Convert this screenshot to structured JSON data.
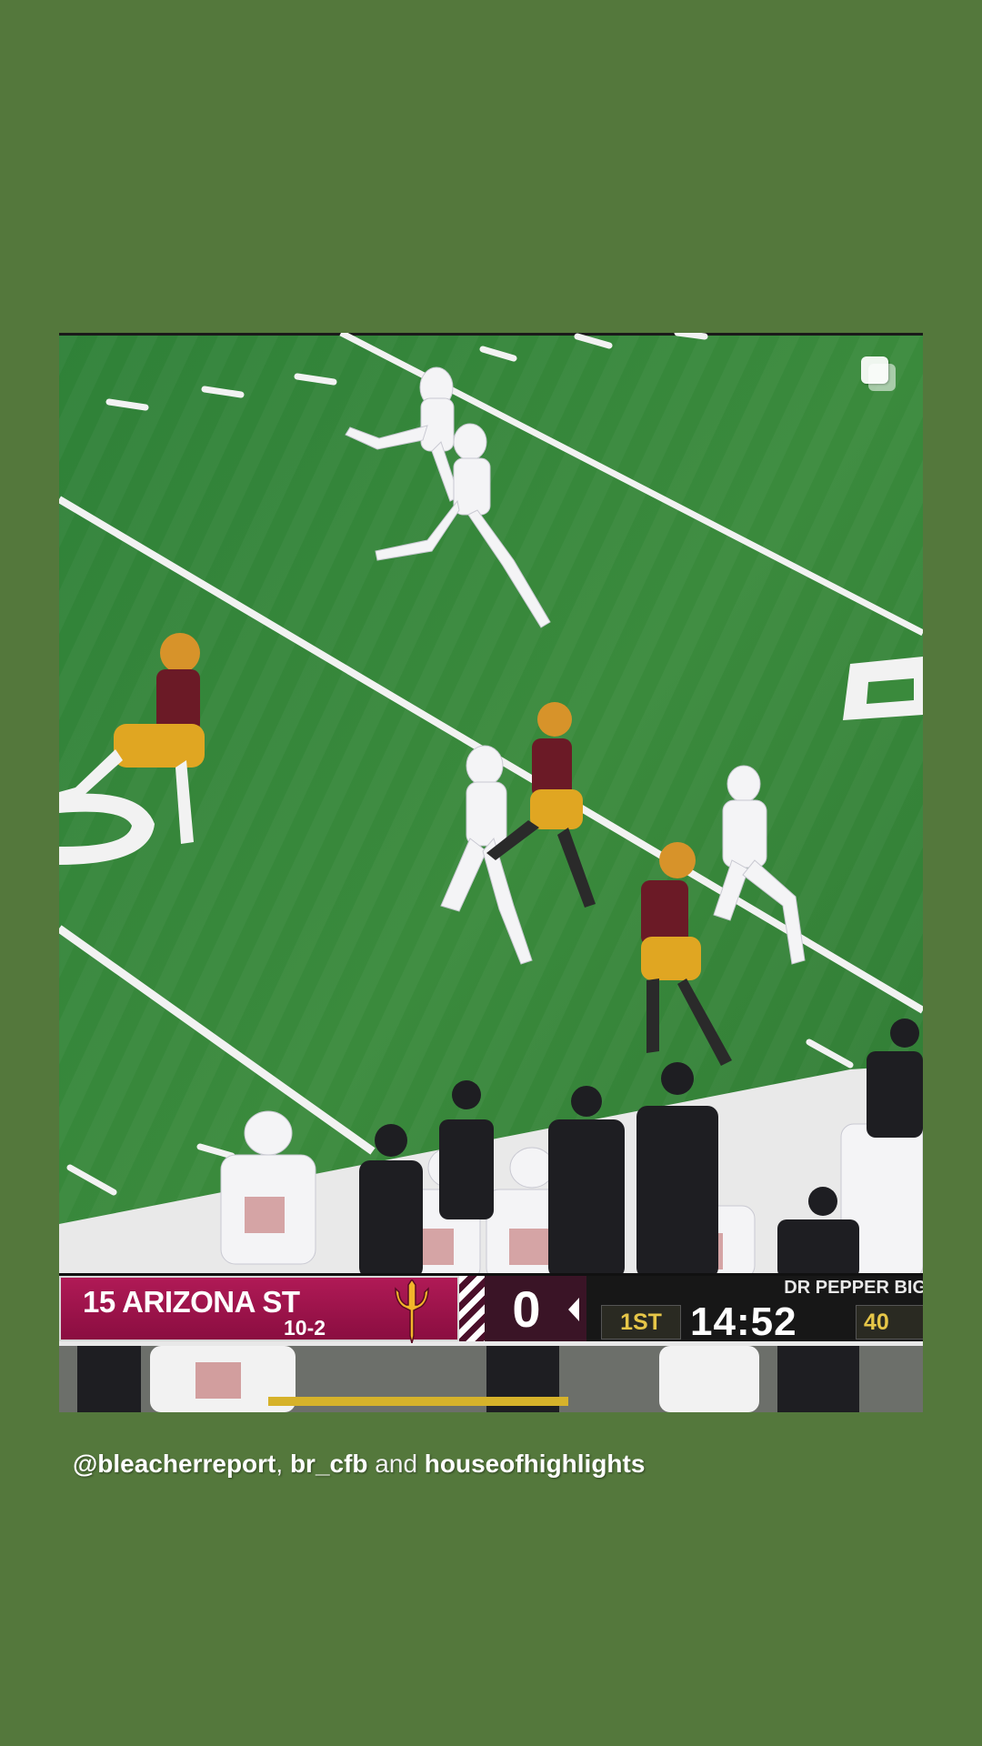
{
  "post": {
    "media_description_icon": "carousel-multiple-icon",
    "scorebug": {
      "team_rank": "15",
      "team_name": "15 ARIZONA ST",
      "team_record": "10-2",
      "team_logo_icon": "pitchfork-logo-icon",
      "score": "0",
      "bowl_name": "DR PEPPER BIG",
      "quarter": "1ST",
      "game_clock": "14:52",
      "play_clock": "40",
      "colors": {
        "team_primary": "#9c1450",
        "team_accent": "#f2b52a",
        "quarter_text": "#e6c648"
      }
    }
  },
  "caption": {
    "user1": "@bleacherreport",
    "separator": ",",
    "user2": "br_cfb",
    "conjunction": "and",
    "user3": "houseofhighlights"
  },
  "colors": {
    "background": "#54783c",
    "field": "#3d7d37"
  }
}
